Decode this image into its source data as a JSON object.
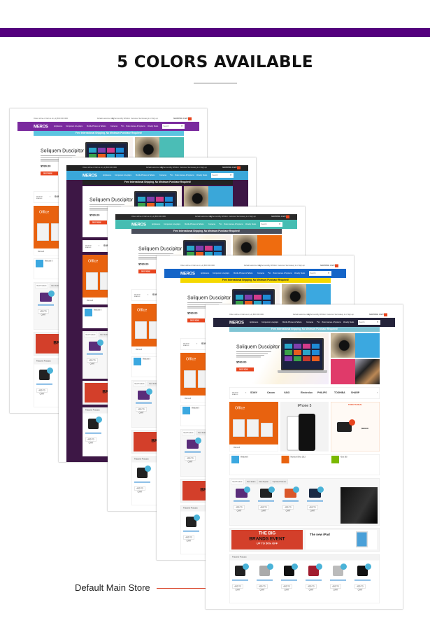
{
  "header": {
    "title": "5 COLORS AVAILABLE"
  },
  "label": "Default Main Store",
  "common": {
    "top_left": "Order online or Call us at (+1) 800 000 0000",
    "top_links": [
      "Default welcome msg!",
      "My Account",
      "My Wishlist",
      "Customer Services",
      "Log in or Sign up"
    ],
    "cart": "SHOPPING CART",
    "logo": "MEROS",
    "nav": [
      "Appliances",
      "Computers & Laptops",
      "Mobile Phones & Tablets",
      "Cameras",
      "TVs",
      "Video Games & Systems",
      "Weekly Deals"
    ],
    "search_placeholder": "Search",
    "shipping": "Free International Shipping. No Minimum Purchase Required!",
    "hero_title": "Soliquem Duscipitor",
    "hero_price": "$590.00",
    "shop_now": "SHOP NOW",
    "brands_label": "SHOP BY BRANDS",
    "brands": [
      "SONY",
      "Canon",
      "VAIO",
      "Electrolux",
      "PHILIPS",
      "TOSHIBA",
      "SHARP"
    ],
    "office": "Office",
    "microsoft": "Microsoft",
    "iphone": "iPhone 5",
    "deal": "TODAY'S DEAL",
    "deal_price": "$900.00",
    "features": [
      "Windows 8",
      "Microsoft Office 2013",
      "Xbox 360"
    ],
    "tabs": [
      "New Products",
      "Best Sellers",
      "Most Popular",
      "Top Rated Products"
    ],
    "add_to_cart": "ADD TO CART",
    "banner": {
      "line1": "THE BIG",
      "line2": "BRANDS EVENT",
      "line3": "UP TO 50% OFF"
    },
    "ipad": "The new iPad",
    "featured": "Featured Products"
  },
  "stores": [
    {
      "top_bg": "#ffffff",
      "top_text": "#666666",
      "nav_bg": "#7a2a9e",
      "ship_bg": "#5bc4e0",
      "ship_text": "#ffffff",
      "page_bg": "#ffffff",
      "hero_block": "#4bbdb6"
    },
    {
      "top_bg": "#222222",
      "top_text": "#cccccc",
      "nav_bg": "#3aa7d9",
      "ship_bg": "#232323",
      "ship_text": "#ffffff",
      "page_bg": "#3d1745",
      "hero_block": "#3aa7d9"
    },
    {
      "top_bg": "#2a2a2a",
      "top_text": "#cccccc",
      "nav_bg": "#45bdb2",
      "ship_bg": "#4a4f5c",
      "ship_text": "#ffffff",
      "page_bg": "#ffffff",
      "hero_block": "#ef6c0f"
    },
    {
      "top_bg": "#ffffff",
      "top_text": "#666666",
      "nav_bg": "#1565c8",
      "ship_bg": "#f5d800",
      "ship_text": "#222222",
      "page_bg": "#ffffff",
      "hero_block": "#3ba8e0"
    },
    {
      "top_bg": "#ffffff",
      "top_text": "#666666",
      "nav_bg": "#24233a",
      "ship_bg": "#7fc4d4",
      "ship_text": "#ffffff",
      "page_bg": "#ffffff",
      "hero_block": "#3ba8e0"
    }
  ]
}
